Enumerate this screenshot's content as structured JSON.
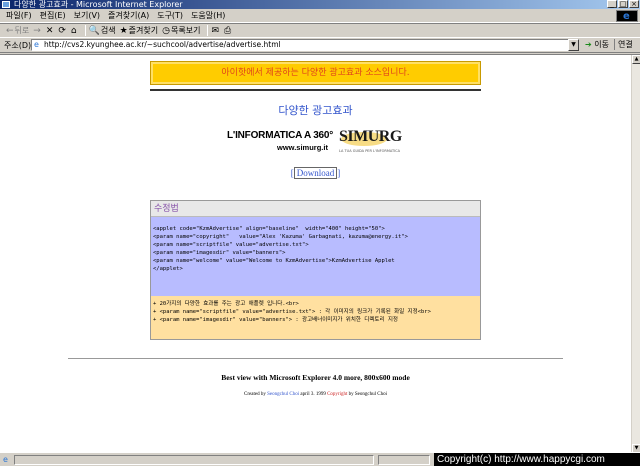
{
  "window": {
    "title": "다양한 광고효과 - Microsoft Internet Explorer",
    "minimize": "_",
    "maximize": "□",
    "close": "×"
  },
  "menu": [
    "파일(F)",
    "편집(E)",
    "보기(V)",
    "즐겨찾기(A)",
    "도구(T)",
    "도움말(H)"
  ],
  "toolbar": {
    "back": "뒤로",
    "back_icon": "←",
    "forward_icon": "→",
    "stop_icon": "✕",
    "refresh_icon": "⟳",
    "home_icon": "⌂",
    "search": "검색",
    "search_icon": "🔍",
    "favorites": "즐겨찾기",
    "favorites_icon": "★",
    "history": "목록보기",
    "history_icon": "◷",
    "mail_icon": "✉",
    "print_icon": "⎙"
  },
  "address": {
    "label": "주소(D)",
    "url": "http://cvs2.kyunghee.ac.kr/~suchcool/advertise/advertise.html",
    "go": "이동",
    "links": "연결"
  },
  "page": {
    "banner_text": "아이핫에서 제공하는 다양한 광고효과 소스입니다.",
    "heading": "다양한 광고효과",
    "ad_main": "L'INFORMATICA A 360°",
    "ad_url": "www.simurg.it",
    "ad_logo": "SIMURG",
    "ad_logo_tag": "LA TUA GUIDA PER L'INFORMATICA",
    "download": "Download",
    "code_title": "수정법",
    "code_lines": "<applet code=\"KzmAdvertise\" align=\"baseline\"  width=\"400\" height=\"50\">\n<param name=\"copyright\"   value=\"Alex 'Kazuma' Garbagnati, kazuma@energy.it\">\n<param name=\"scriptfile\" value=\"advertise.txt\">\n<param name=\"imagesdir\" value=\"banners\">\n<param name=\"welcome\" value=\"Welcome to KzmAdvertise\">KzmAdvertise Applet\n</applet>",
    "notes_lines": "+ 20가지의 다양한 효과를 주는 광고 애플렛 입니다.<br>\n+ <param name=\"scriptfile\" value=\"advertise.txt\"> : 각 이미지의 링크가 기록된 화일 지정<br>\n+ <param name=\"imagesdir\" value=\"banners\"> : 광고배너이미지가 위치한 디렉토리 지정",
    "best_view": "Best view with Microsoft Explorer 4.0 more, 800x600 mode",
    "credit_prefix": "Created by",
    "credit_name": "Seongchul Choi",
    "credit_date": "april 3. 1999",
    "credit_copy": "Copyright",
    "credit_by": "by",
    "credit_name2": "Seongchul Choi"
  },
  "status": {
    "watermark": "Copyright(c) http://www.happycgi.com"
  },
  "colors": {
    "banner_bg": "#ffcc00",
    "banner_text": "#e0451b",
    "heading": "#3355cc",
    "code_bg": "#b8bcff",
    "notes_bg": "#ffe0a0"
  }
}
